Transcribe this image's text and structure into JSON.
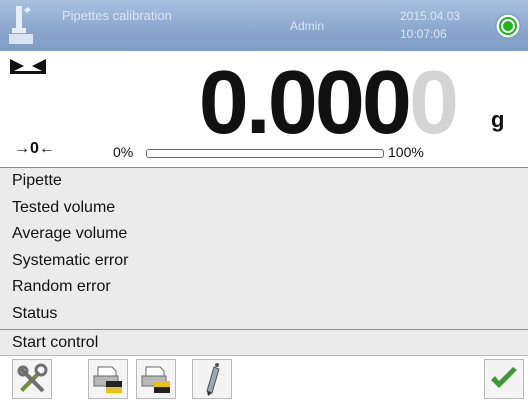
{
  "header": {
    "title": "Pipettes calibration",
    "subtitle": "",
    "user": "Admin",
    "date": "2015.04.03",
    "time": "10:07:06",
    "logo_icon": "balance-logo-icon",
    "status_icon": "green-status-icon"
  },
  "weighing": {
    "reading_main": "0.000",
    "reading_last": "0",
    "unit": "g",
    "zero_indicator": "→0←",
    "stability_icon": "stability-marker-icon",
    "bar_min_label": "0%",
    "bar_max_label": "100%",
    "bar_fill_fraction": 0
  },
  "info": {
    "rows": [
      "Pipette",
      "Tested volume",
      "Average volume",
      "Systematic error",
      "Random error",
      "Status"
    ]
  },
  "start_control": "Start control",
  "toolbar": {
    "buttons": [
      {
        "icon": "tools-settings-icon"
      },
      {
        "icon": "printer-header-icon"
      },
      {
        "icon": "printer-footer-icon"
      },
      {
        "icon": "info-pen-icon"
      },
      {
        "icon": "confirm-check-icon"
      }
    ]
  },
  "colors": {
    "header_top": "#a9c1df",
    "header_bottom": "#7f9dc6",
    "panel_gray": "#ebebeb",
    "reading_dim": "#d4d4d4",
    "status_green": "#1fb31f",
    "check_green": "#3e9a32"
  }
}
